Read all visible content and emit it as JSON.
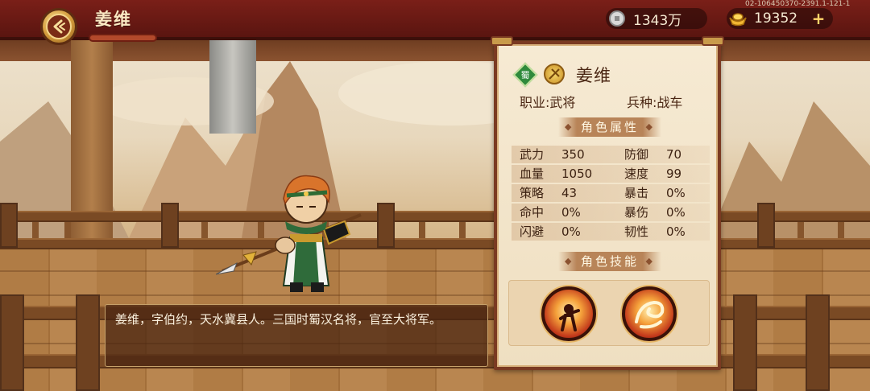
{
  "header": {
    "title": "姜维",
    "version": "02-106450370-2391.1-121-1"
  },
  "resources": {
    "silver": "1343万",
    "gold": "19352",
    "gold_add": "+"
  },
  "hero": {
    "name": "姜维",
    "faction": "蜀",
    "profession_label": "职业:",
    "profession": "武将",
    "troop_label": "兵种:",
    "troop": "战车",
    "attributes_title": "角色属性",
    "attributes": [
      {
        "label": "武力",
        "value": "350",
        "label2": "防御",
        "value2": "70"
      },
      {
        "label": "血量",
        "value": "1050",
        "label2": "速度",
        "value2": "99"
      },
      {
        "label": "策略",
        "value": "43",
        "label2": "暴击",
        "value2": "0%"
      },
      {
        "label": "命中",
        "value": "0%",
        "label2": "暴伤",
        "value2": "0%"
      },
      {
        "label": "闪避",
        "value": "0%",
        "label2": "韧性",
        "value2": "0%"
      }
    ],
    "skills_title": "角色技能",
    "skills": [
      {
        "icon": "warrior-burst-skill-icon"
      },
      {
        "icon": "fire-dragon-skill-icon"
      }
    ]
  },
  "description": "姜维，字伯约，天水冀县人。三国时蜀汉名将，官至大将军。",
  "colors": {
    "header_red": "#7a1f18",
    "panel_bg": "#f6ead3",
    "panel_border": "#7a3a22",
    "accent_gold": "#f6d76c"
  }
}
